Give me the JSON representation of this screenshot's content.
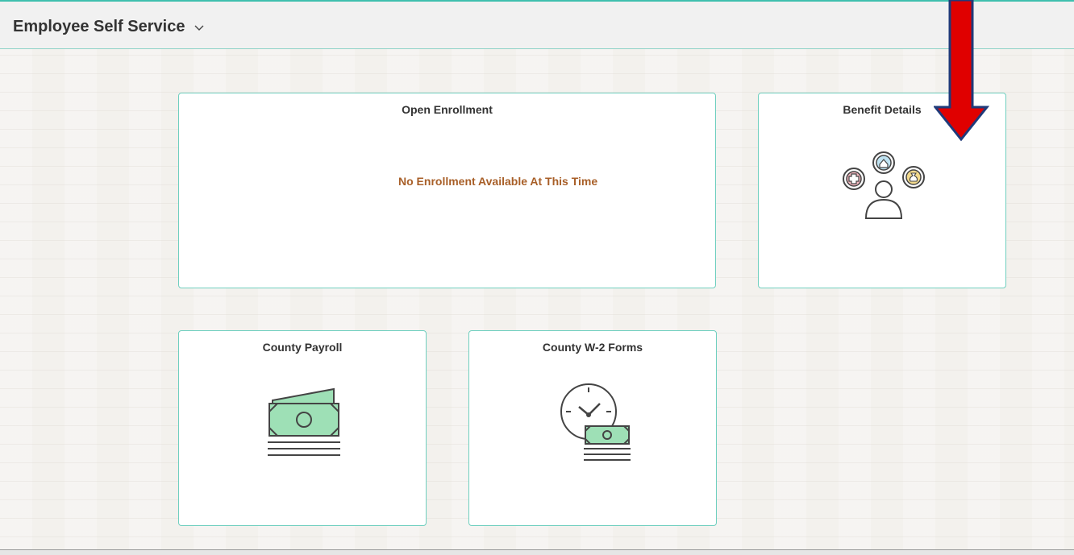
{
  "header": {
    "title": "Employee Self Service",
    "menu_icon": "chevron-down-icon"
  },
  "tiles": [
    {
      "title": "Open Enrollment",
      "message": "No Enrollment Available At This Time"
    },
    {
      "title": "Benefit Details",
      "icon": "benefits-person-icon"
    },
    {
      "title": "County Payroll",
      "icon": "money-stack-icon"
    },
    {
      "title": "County W-2 Forms",
      "icon": "clock-money-icon"
    }
  ],
  "annotation": {
    "icon": "red-down-arrow",
    "color": "#e00000"
  },
  "colors": {
    "tile_border": "#6fcfbf",
    "header_accent": "#3fbfae",
    "message": "#a85f28"
  }
}
